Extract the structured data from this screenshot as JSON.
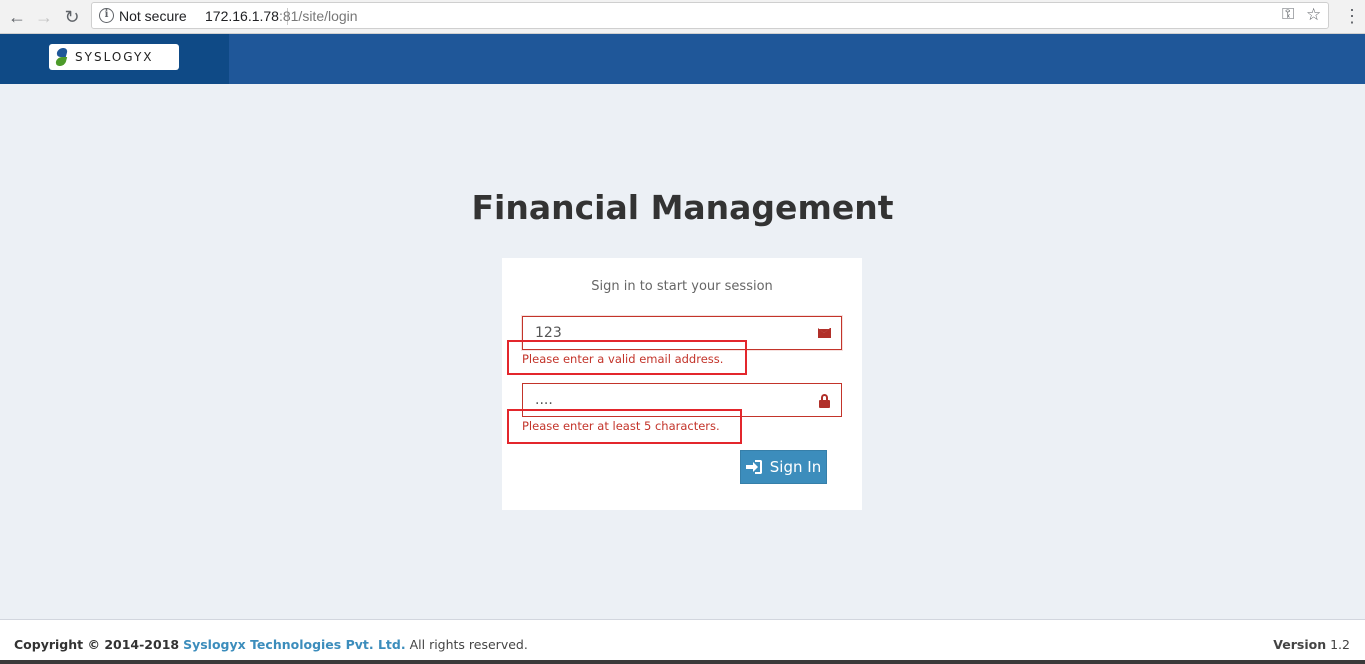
{
  "browser": {
    "back_icon": "←",
    "forward_icon": "→",
    "reload_icon": "↻",
    "security_label": "Not secure",
    "url_host": "172.16.1.78",
    "url_rest": ":81/site/login",
    "key_icon": "⚿",
    "star_icon": "☆",
    "menu_icon": "⋮"
  },
  "header": {
    "logo_text": "SYSLOGYX"
  },
  "main": {
    "title": "Financial Management",
    "login_message": "Sign in to start your session",
    "email_value": "123",
    "email_error": "Please enter a valid email address.",
    "password_value": "....",
    "password_error": "Please enter at least 5 characters.",
    "signin_label": "Sign In"
  },
  "footer": {
    "copyright_prefix": "Copyright © 2014-2018",
    "company": "Syslogyx Technologies Pvt. Ltd.",
    "rights": "All rights reserved.",
    "version_label": "Version",
    "version_number": "1.2"
  },
  "colors": {
    "header_bg": "#1f5799",
    "logo_bg": "#0f4a86",
    "error": "#c3342a",
    "button": "#3c8dbc"
  }
}
